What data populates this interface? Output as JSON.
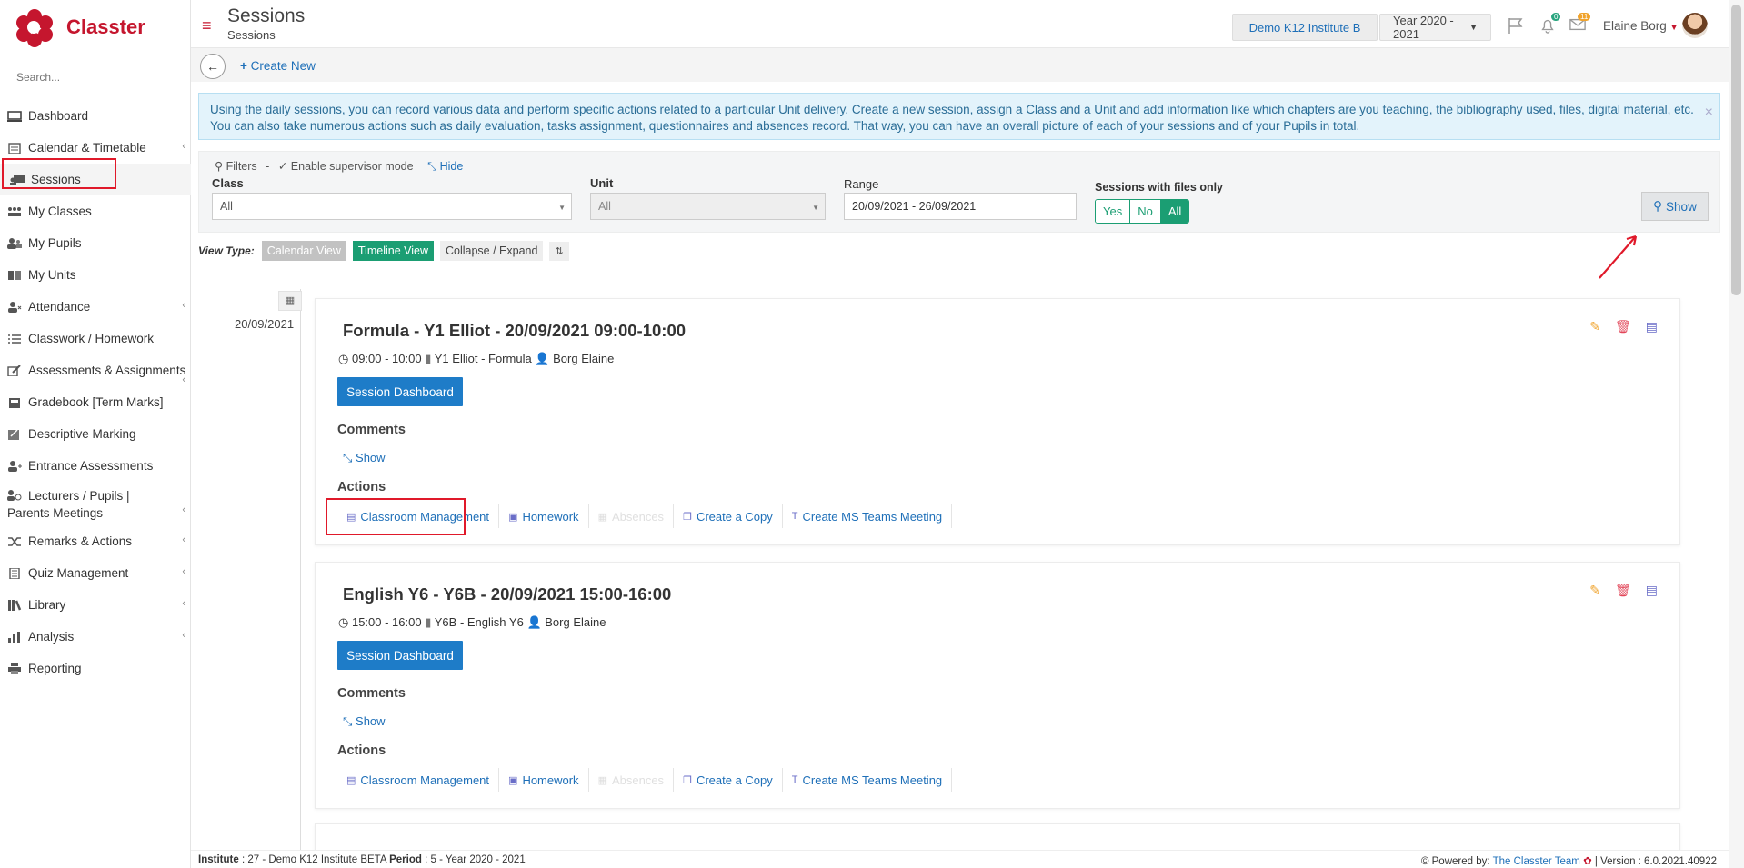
{
  "app": {
    "name": "Classter",
    "brand_color": "#c5162e"
  },
  "search": {
    "placeholder": "Search..."
  },
  "sidebar": {
    "items": [
      {
        "label": "Dashboard",
        "icon": "monitor-icon",
        "caret": false
      },
      {
        "label": "Calendar & Timetable",
        "icon": "calendar-icon",
        "caret": true
      },
      {
        "label": "Sessions",
        "icon": "sessions-icon",
        "caret": false,
        "active": true
      },
      {
        "label": "My Classes",
        "icon": "classes-icon",
        "caret": false
      },
      {
        "label": "My Pupils",
        "icon": "pupils-icon",
        "caret": false
      },
      {
        "label": "My Units",
        "icon": "book-icon",
        "caret": false
      },
      {
        "label": "Attendance",
        "icon": "attendance-icon",
        "caret": true
      },
      {
        "label": "Classwork / Homework",
        "icon": "list-icon",
        "caret": false
      },
      {
        "label": "Assessments & Assignments",
        "icon": "edit-icon",
        "caret": true
      },
      {
        "label": "Gradebook [Term Marks]",
        "icon": "gradebook-icon",
        "caret": false
      },
      {
        "label": "Descriptive Marking",
        "icon": "marking-icon",
        "caret": false
      },
      {
        "label": "Entrance Assessments",
        "icon": "entrance-icon",
        "caret": false
      },
      {
        "label": "Lecturers / Pupils | Parents Meetings",
        "icon": "meetings-icon",
        "caret": true
      },
      {
        "label": "Remarks & Actions",
        "icon": "shuffle-icon",
        "caret": true
      },
      {
        "label": "Quiz Management",
        "icon": "quiz-icon",
        "caret": true
      },
      {
        "label": "Library",
        "icon": "library-icon",
        "caret": true
      },
      {
        "label": "Analysis",
        "icon": "analysis-icon",
        "caret": true
      },
      {
        "label": "Reporting",
        "icon": "printer-icon",
        "caret": false
      }
    ]
  },
  "header": {
    "title": "Sessions",
    "subtitle": "Sessions",
    "institute": "Demo K12 Institute B",
    "year": "Year 2020 - 2021",
    "notifications_count": "0",
    "messages_count": "11",
    "user_name": "Elaine Borg"
  },
  "toolbar": {
    "create_new": "Create New"
  },
  "info_text": "Using the daily sessions, you can record various data and perform specific actions related to a particular Unit delivery. Create a new session, assign a Class and a Unit and add information like which chapters are you teaching, the bibliography used, files, digital material, etc. You can also take numerous actions such as daily evaluation, tasks assignment, questionnaires and absences record. That way, you can have an overall picture of each of your sessions and of your Pupils in total.",
  "filters": {
    "filters_label": "Filters",
    "supervisor_label": "Enable supervisor mode",
    "hide_label": "Hide",
    "class_label": "Class",
    "class_value": "All",
    "unit_label": "Unit",
    "unit_value": "All",
    "range_label": "Range",
    "range_value": "20/09/2021 - 26/09/2021",
    "files_label": "Sessions with files only",
    "yes": "Yes",
    "no": "No",
    "all": "All",
    "show_button": "Show"
  },
  "view_type": {
    "label": "View Type:",
    "calendar_view": "Calendar View",
    "timeline_view": "Timeline View",
    "collapse_expand": "Collapse / Expand"
  },
  "timeline": {
    "date": "20/09/2021"
  },
  "sessions": [
    {
      "title": "Formula - Y1 Elliot - 20/09/2021 09:00-10:00",
      "time": "09:00 - 10:00",
      "unit": "Y1 Elliot - Formula",
      "teacher": "Borg Elaine",
      "dashboard": "Session Dashboard",
      "comments": "Comments",
      "show": "Show",
      "actions_label": "Actions",
      "actions": [
        "Classroom Management",
        "Homework",
        "Absences",
        "Create a Copy",
        "Create MS Teams Meeting"
      ]
    },
    {
      "title": "English Y6 - Y6B - 20/09/2021 15:00-16:00",
      "time": "15:00 - 16:00",
      "unit": "Y6B - English Y6",
      "teacher": "Borg Elaine",
      "dashboard": "Session Dashboard",
      "comments": "Comments",
      "show": "Show",
      "actions_label": "Actions",
      "actions": [
        "Classroom Management",
        "Homework",
        "Absences",
        "Create a Copy",
        "Create MS Teams Meeting"
      ]
    }
  ],
  "footer": {
    "institute_label": "Institute",
    "institute_value": ": 27 - Demo K12 Institute BETA",
    "period_label": "Period",
    "period_value": ": 5 - Year 2020 - 2021",
    "powered_label": "Powered by:",
    "powered_team": "The Classter Team",
    "version": "| Version : 6.0.2021.40922"
  },
  "colors": {
    "green": "#1b9e73",
    "blue": "#1e7cc8",
    "link": "#1e6fb8",
    "info_bg": "#e3f3fb",
    "annotation_red": "#e0192a"
  }
}
